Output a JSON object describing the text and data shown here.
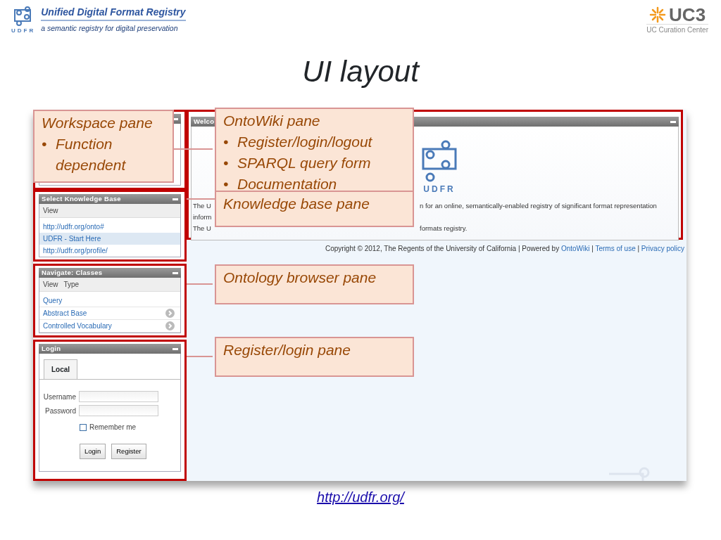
{
  "header": {
    "title": "Unified Digital Format Registry",
    "subtitle": "a semantic registry for digital preservation",
    "logo_text": "UDFR",
    "partner_logo": "UC3",
    "partner_name": "UC Curation Center"
  },
  "slide_title": "UI layout",
  "screenshot": {
    "knowledge_base": {
      "title": "Select Knowledge Base",
      "menu": [
        "View"
      ],
      "items": [
        {
          "label": "http://udfr.org/onto#",
          "selected": false
        },
        {
          "label": "UDFR - Start Here",
          "selected": true
        },
        {
          "label": "http://udfr.org/profile/",
          "selected": false
        }
      ]
    },
    "navigate": {
      "title": "Navigate: Classes",
      "menu": [
        "View",
        "Type"
      ],
      "items": [
        {
          "label": "Query",
          "has_children": false
        },
        {
          "label": "Abstract Base",
          "has_children": true
        },
        {
          "label": "Controlled Vocabulary",
          "has_children": true
        }
      ]
    },
    "login": {
      "title": "Login",
      "tabs": [
        {
          "label": "Local",
          "selected": true
        }
      ],
      "fields": [
        {
          "label": "Username"
        },
        {
          "label": "Password"
        }
      ],
      "remember": {
        "label": "Remember me",
        "checked": false
      },
      "buttons": [
        "Login",
        "Register"
      ]
    },
    "welcome": {
      "title": "Welco",
      "logo_text": "UDFR",
      "lines": [
        {
          "left": "The U",
          "right": "n for an online, semantically-enabled registry of significant format representation"
        },
        {
          "left": "inform"
        },
        {
          "left": "The U",
          "right": "formats registry."
        }
      ]
    },
    "footer": [
      {
        "kind": "text",
        "text": "Copyright © 2012, The Regents of the University of California | Powered by "
      },
      {
        "kind": "link",
        "text": "OntoWiki"
      },
      {
        "kind": "text",
        "text": " | "
      },
      {
        "kind": "link",
        "text": "Terms of use"
      },
      {
        "kind": "text",
        "text": " | "
      },
      {
        "kind": "link",
        "text": "Privacy policy"
      }
    ]
  },
  "callouts": [
    {
      "title": "Workspace pane",
      "bullets": [
        {
          "marker": "•",
          "text": "Function dependent"
        }
      ]
    },
    {
      "title": "OntoWiki pane",
      "bullets": [
        {
          "marker": "•",
          "text": "Register/login/logout"
        },
        {
          "marker": "•",
          "text": "SPARQL query form"
        },
        {
          "marker": "•",
          "text": "Documentation"
        }
      ]
    },
    {
      "title": "Knowledge base pane"
    },
    {
      "title": "Ontology browser pane"
    },
    {
      "title": "Register/login pane"
    }
  ],
  "link": "http://udfr.org/"
}
